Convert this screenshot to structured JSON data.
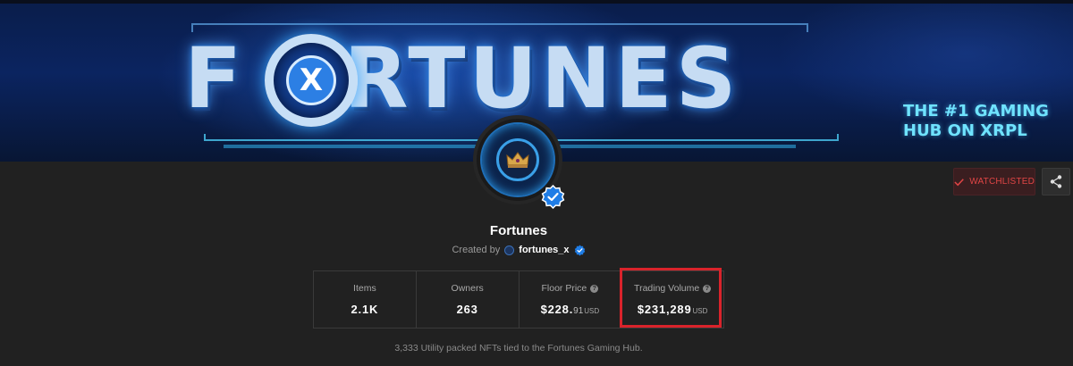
{
  "banner": {
    "title": "FORTUNES",
    "title_before_o": "F",
    "title_after_o": "RTUNES",
    "x_glyph": "X",
    "tagline_line1": "THE #1 GAMING",
    "tagline_line2": "HUB ON XRPL"
  },
  "actions": {
    "watchlist_label": "WATCHLISTED",
    "share_icon": "share-icon"
  },
  "collection": {
    "name": "Fortunes",
    "created_by_label": "Created by",
    "creator_handle": "fortunes_x",
    "description": "3,333 Utility packed NFTs tied to the Fortunes Gaming Hub."
  },
  "stats": {
    "items_label": "Items",
    "items_value": "2.1K",
    "owners_label": "Owners",
    "owners_value": "263",
    "floor_label": "Floor Price",
    "floor_value_main": "$228.",
    "floor_value_decimals": "91",
    "floor_unit": "USD",
    "volume_label": "Trading Volume",
    "volume_value": "$231,289",
    "volume_unit": "USD",
    "help_glyph": "?"
  },
  "colors": {
    "page_bg": "#212121",
    "highlight_red": "#d9232b",
    "watchlist_red": "#e04545",
    "verified_blue": "#1f7de6"
  }
}
